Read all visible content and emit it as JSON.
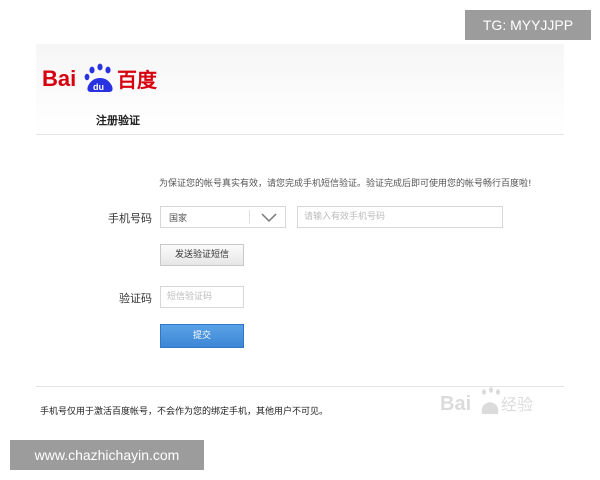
{
  "header": {
    "logo_text": "Bai du 百度",
    "page_title": "注册验证"
  },
  "notice": "为保证您的帐号真实有效，请您完成手机短信验证。验证完成后即可使用您的帐号畅行百度啦!",
  "form": {
    "phone_label": "手机号码",
    "country_value": "国家",
    "phone_placeholder": "请输入有效手机号码",
    "send_sms_label": "发送验证短信",
    "code_label": "验证码",
    "code_placeholder": "短信验证码",
    "submit_label": "提交"
  },
  "footer": {
    "note": "手机号仅用于激活百度帐号，不会作为您的绑定手机，其他用户不可见。"
  },
  "overlays": {
    "tg_badge": "TG: MYYJJPP",
    "site_badge": "www.chazhichayin.com",
    "watermark_text": "Bai du 经验"
  },
  "colors": {
    "brand_red": "#d7000f",
    "brand_blue": "#2932e1",
    "submit_blue": "#3c86d6"
  }
}
